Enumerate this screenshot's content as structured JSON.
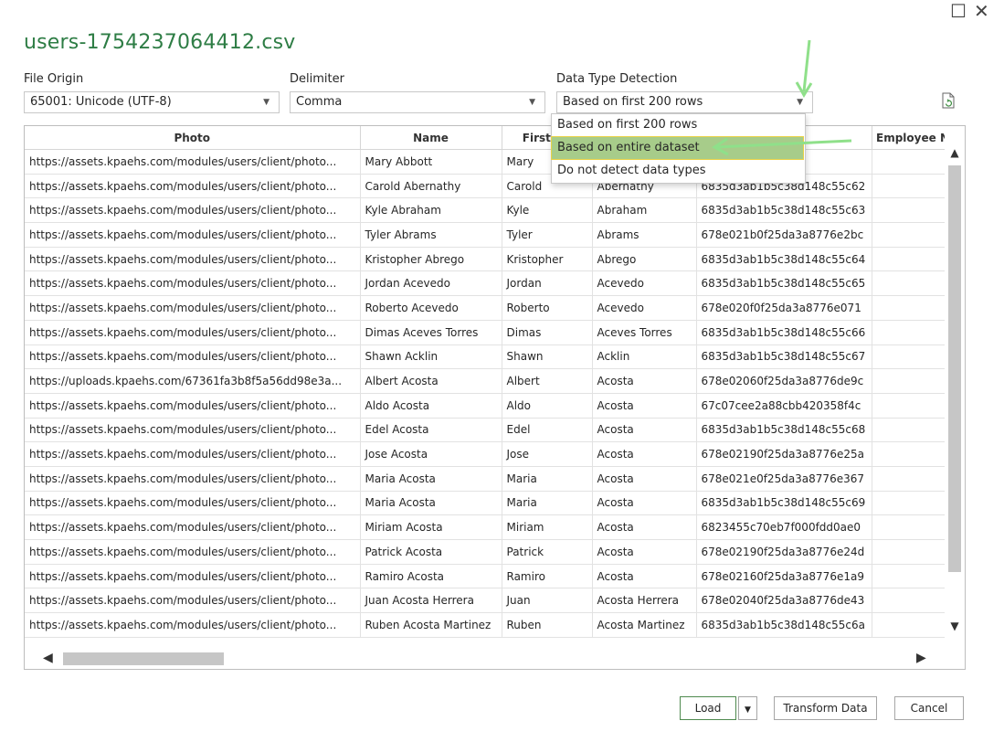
{
  "window": {
    "maximize_glyph": "☐",
    "close_glyph": "✕"
  },
  "title": "users-1754237064412.csv",
  "file_origin": {
    "label": "File Origin",
    "value": "65001: Unicode (UTF-8)"
  },
  "delimiter": {
    "label": "Delimiter",
    "value": "Comma"
  },
  "data_type_detection": {
    "label": "Data Type Detection",
    "value": "Based on first 200 rows",
    "options": [
      "Based on first 200 rows",
      "Based on entire dataset",
      "Do not detect data types"
    ],
    "highlighted_index": 1
  },
  "colors": {
    "title": "#2e7d45",
    "highlight": "#a7cc8a",
    "highlight_border": "#e9d247",
    "annotation_arrow": "#8fe08a"
  },
  "icons": {
    "refresh": "refresh-file-icon",
    "dropdown": "chevron-down-icon"
  },
  "grid": {
    "columns": [
      "Photo",
      "Name",
      "First Na",
      "",
      "",
      "Employee N"
    ],
    "rows": [
      [
        "https://assets.kpaehs.com/modules/users/client/photo...",
        "Mary Abbott",
        "Mary",
        "",
        "a8776e174",
        ""
      ],
      [
        "https://assets.kpaehs.com/modules/users/client/photo...",
        "Carold Abernathy",
        "Carold",
        "Abernathy",
        "6835d3ab1b5c38d148c55c62",
        ""
      ],
      [
        "https://assets.kpaehs.com/modules/users/client/photo...",
        "Kyle Abraham",
        "Kyle",
        "Abraham",
        "6835d3ab1b5c38d148c55c63",
        ""
      ],
      [
        "https://assets.kpaehs.com/modules/users/client/photo...",
        "Tyler Abrams",
        "Tyler",
        "Abrams",
        "678e021b0f25da3a8776e2bc",
        ""
      ],
      [
        "https://assets.kpaehs.com/modules/users/client/photo...",
        "Kristopher Abrego",
        "Kristopher",
        "Abrego",
        "6835d3ab1b5c38d148c55c64",
        ""
      ],
      [
        "https://assets.kpaehs.com/modules/users/client/photo...",
        "Jordan Acevedo",
        "Jordan",
        "Acevedo",
        "6835d3ab1b5c38d148c55c65",
        ""
      ],
      [
        "https://assets.kpaehs.com/modules/users/client/photo...",
        "Roberto Acevedo",
        "Roberto",
        "Acevedo",
        "678e020f0f25da3a8776e071",
        ""
      ],
      [
        "https://assets.kpaehs.com/modules/users/client/photo...",
        "Dimas Aceves Torres",
        "Dimas",
        "Aceves Torres",
        "6835d3ab1b5c38d148c55c66",
        ""
      ],
      [
        "https://assets.kpaehs.com/modules/users/client/photo...",
        "Shawn Acklin",
        "Shawn",
        "Acklin",
        "6835d3ab1b5c38d148c55c67",
        ""
      ],
      [
        "https://uploads.kpaehs.com/67361fa3b8f5a56dd98e3a...",
        "Albert Acosta",
        "Albert",
        "Acosta",
        "678e02060f25da3a8776de9c",
        ""
      ],
      [
        "https://assets.kpaehs.com/modules/users/client/photo...",
        "Aldo Acosta",
        "Aldo",
        "Acosta",
        "67c07cee2a88cbb420358f4c",
        ""
      ],
      [
        "https://assets.kpaehs.com/modules/users/client/photo...",
        "Edel Acosta",
        "Edel",
        "Acosta",
        "6835d3ab1b5c38d148c55c68",
        ""
      ],
      [
        "https://assets.kpaehs.com/modules/users/client/photo...",
        "Jose Acosta",
        "Jose",
        "Acosta",
        "678e02190f25da3a8776e25a",
        ""
      ],
      [
        "https://assets.kpaehs.com/modules/users/client/photo...",
        "Maria Acosta",
        "Maria",
        "Acosta",
        "678e021e0f25da3a8776e367",
        ""
      ],
      [
        "https://assets.kpaehs.com/modules/users/client/photo...",
        "Maria Acosta",
        "Maria",
        "Acosta",
        "6835d3ab1b5c38d148c55c69",
        ""
      ],
      [
        "https://assets.kpaehs.com/modules/users/client/photo...",
        "Miriam Acosta",
        "Miriam",
        "Acosta",
        "6823455c70eb7f000fdd0ae0",
        ""
      ],
      [
        "https://assets.kpaehs.com/modules/users/client/photo...",
        "Patrick Acosta",
        "Patrick",
        "Acosta",
        "678e02190f25da3a8776e24d",
        ""
      ],
      [
        "https://assets.kpaehs.com/modules/users/client/photo...",
        "Ramiro Acosta",
        "Ramiro",
        "Acosta",
        "678e02160f25da3a8776e1a9",
        ""
      ],
      [
        "https://assets.kpaehs.com/modules/users/client/photo...",
        "Juan Acosta Herrera",
        "Juan",
        "Acosta Herrera",
        "678e02040f25da3a8776de43",
        ""
      ],
      [
        "https://assets.kpaehs.com/modules/users/client/photo...",
        "Ruben Acosta Martinez",
        "Ruben",
        "Acosta Martinez",
        "6835d3ab1b5c38d148c55c6a",
        ""
      ]
    ]
  },
  "buttons": {
    "load": "Load",
    "transform": "Transform Data",
    "cancel": "Cancel"
  }
}
